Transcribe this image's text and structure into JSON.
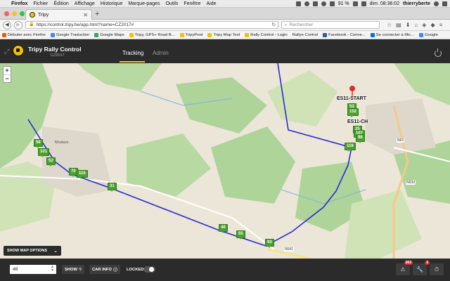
{
  "menubar": {
    "app": "Firefox",
    "items": [
      "Fichier",
      "Édition",
      "Affichage",
      "Historique",
      "Marque-pages",
      "Outils",
      "Fenêtre",
      "Aide"
    ],
    "battery": "91 %",
    "clock": "dim. 08:36:02",
    "user": "thierryberte"
  },
  "browser": {
    "tab_title": "Tripy",
    "url": "https://control.tripy.be/app.html?name=CZ2017#",
    "search_placeholder": "Rechercher",
    "bookmarks": [
      {
        "label": "Débuter avec Firefox",
        "color": "#e66000"
      },
      {
        "label": "Google Traduction",
        "color": "#4285f4"
      },
      {
        "label": "Google Maps",
        "color": "#34a853"
      },
      {
        "label": "Tripy, GPS+ Road B...",
        "color": "#f2c200"
      },
      {
        "label": "TripyProd",
        "color": "#f2c200"
      },
      {
        "label": "Tripy Map Tool",
        "color": "#f2c200"
      },
      {
        "label": "Rally Control - Login",
        "color": "#f2c200"
      },
      {
        "label": "Rallye Control",
        "color": "#888888"
      },
      {
        "label": "Facebook - Conne...",
        "color": "#3b5998"
      },
      {
        "label": "Se connecter à Mic...",
        "color": "#0078d7"
      },
      {
        "label": "Google",
        "color": "#4285f4"
      }
    ]
  },
  "app": {
    "brand": "Tripy Rally Control",
    "event": "CZ2017",
    "tabs": [
      {
        "label": "Tracking",
        "active": true
      },
      {
        "label": "Admin",
        "active": false
      }
    ]
  },
  "map": {
    "zoom_in": "+",
    "zoom_out": "−",
    "show_options_label": "SHOW MAP OPTIONS",
    "labels": {
      "es_start": "ES11-START",
      "es_ch": "ES11-CH",
      "town": "Modave",
      "road1": "N63",
      "road2": "N641",
      "road3": "N63d"
    },
    "markers": [
      "58",
      "101",
      "52",
      "70",
      "115",
      "31",
      "40",
      "55",
      "93",
      "119",
      "53",
      "152",
      "25",
      "107",
      "98"
    ]
  },
  "bottombar": {
    "car_number": "48",
    "show_label": "SHOW",
    "carinfo_label": "CAR INFO",
    "locked_label": "LOCKED",
    "alerts_count": "263",
    "tools_count": "3"
  }
}
